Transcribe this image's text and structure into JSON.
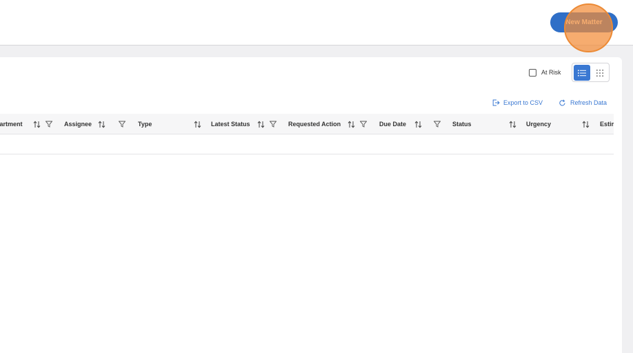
{
  "header": {
    "new_matter_label": "New Matter"
  },
  "toolbar": {
    "at_risk_label": "At Risk",
    "at_risk_checked": false,
    "view_mode": "list",
    "export_label": "Export to CSV",
    "refresh_label": "Refresh Data"
  },
  "table": {
    "columns": [
      {
        "label": "Department",
        "visible_label": "partment",
        "sortable": true,
        "filterable": true
      },
      {
        "label": "Assignee",
        "sortable": true,
        "filterable": true
      },
      {
        "label": "Type",
        "sortable": true,
        "filterable": false
      },
      {
        "label": "Latest Status",
        "sortable": true,
        "filterable": true
      },
      {
        "label": "Requested Action",
        "sortable": true,
        "filterable": true
      },
      {
        "label": "Due Date",
        "sortable": true,
        "filterable": true
      },
      {
        "label": "Status",
        "sortable": true,
        "filterable": false
      },
      {
        "label": "Urgency",
        "sortable": true,
        "filterable": false
      },
      {
        "label": "Estimated",
        "visible_label": "Estim",
        "sortable": false,
        "filterable": false
      }
    ],
    "rows": []
  },
  "colors": {
    "accent": "#2f6fc7",
    "highlight": "#ec8a35"
  }
}
